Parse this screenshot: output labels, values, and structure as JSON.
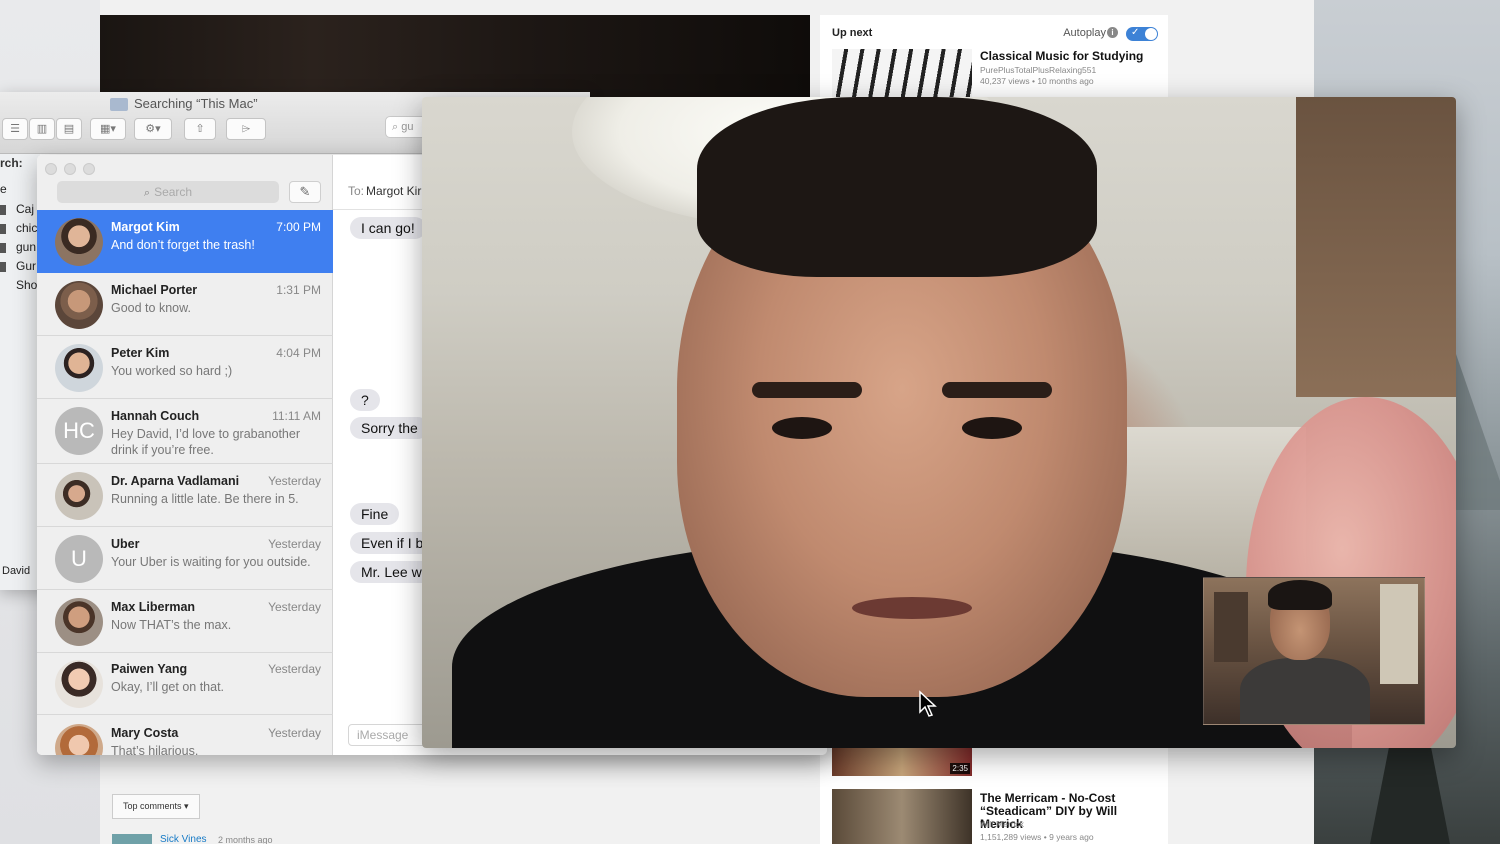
{
  "youtube": {
    "up_next_label": "Up next",
    "autoplay_label": "Autoplay",
    "videos": [
      {
        "title": "Classical Music for Studying",
        "channel": "PurePlusTotalPlusRelaxing551",
        "meta": "40,237 views • 10 months ago"
      },
      {
        "duration": "2:35"
      },
      {
        "title": "The Merricam - No-Cost “Steadicam” DIY by Will Merrick",
        "channel": "Will Merrick",
        "meta": "1,151,289 views • 9 years ago"
      }
    ],
    "comments_sort_label": "Top comments",
    "first_commenter": "Sick Vines",
    "first_comment_time": "2 months ago"
  },
  "finder": {
    "title": "Searching “This Mac”",
    "search_value": "gu",
    "search_scope_label": "rch:",
    "sidebar_header": "e",
    "rows": [
      "Caj",
      "chic",
      "gun",
      "Gur",
      "Sho"
    ],
    "user_label": "David"
  },
  "messages": {
    "search_placeholder": "Search",
    "conversations": [
      {
        "name": "Margot Kim",
        "time": "7:00 PM",
        "preview": "And don’t forget the trash!"
      },
      {
        "name": "Michael Porter",
        "time": "1:31 PM",
        "preview": "Good to know."
      },
      {
        "name": "Peter Kim",
        "time": "4:04 PM",
        "preview": "You worked so hard ;)"
      },
      {
        "name": "Hannah Couch",
        "time": "11:11 AM",
        "preview": "Hey David, I’d love to grabanother drink if you’re free.",
        "initials": "HC"
      },
      {
        "name": "Dr. Aparna Vadlamani",
        "time": "Yesterday",
        "preview": "Running a little late. Be there in 5."
      },
      {
        "name": "Uber",
        "time": "Yesterday",
        "preview": "Your Uber is waiting for you outside.",
        "initials": "U"
      },
      {
        "name": "Max Liberman",
        "time": "Yesterday",
        "preview": "Now THAT’s the max."
      },
      {
        "name": "Paiwen Yang",
        "time": "Yesterday",
        "preview": "Okay, I’ll get on that."
      },
      {
        "name": "Mary Costa",
        "time": "Yesterday",
        "preview": "That’s hilarious."
      }
    ],
    "to_label": "To:",
    "to_name": "Margot Kir",
    "bubbles": [
      "I can go!",
      "?",
      "Sorry the",
      "Fine",
      "Even if I b",
      "Mr. Lee w"
    ],
    "input_placeholder": "iMessage"
  },
  "colors": {
    "selected_row": "#3f7ff0",
    "autoplay_toggle": "#3d82d6"
  }
}
